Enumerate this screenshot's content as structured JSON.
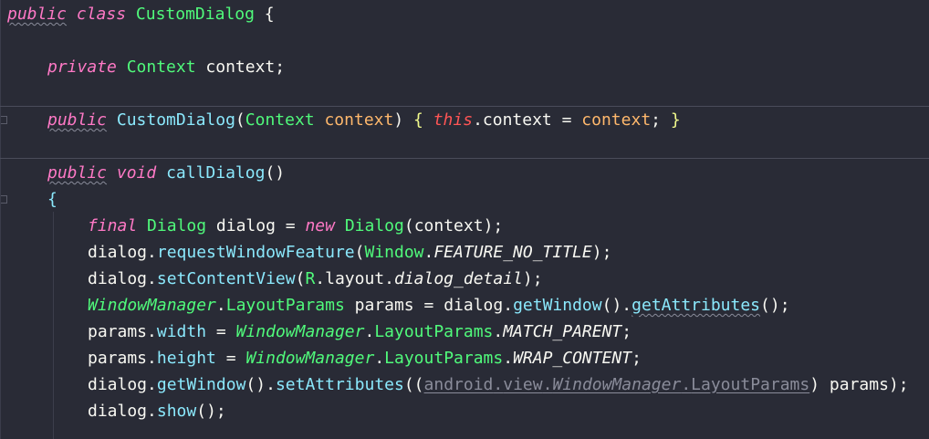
{
  "code": {
    "l1": {
      "public": "public",
      "class": "class",
      "name": "CustomDialog",
      "brace": "{"
    },
    "l2": {
      "private": "private",
      "type": "Context",
      "var": "context",
      "semi": ";"
    },
    "l3": {
      "public": "public",
      "name": "CustomDialog",
      "open": "(",
      "ptype": "Context",
      "pname": "context",
      "close": ")",
      "lbrace": "{",
      "this": "this",
      "dot": ".",
      "field": "context",
      "eq": "=",
      "rhs": "context",
      "semi": ";",
      "rbrace": "}"
    },
    "l4": {
      "public": "public",
      "void": "void",
      "name": "callDialog",
      "parens": "()"
    },
    "l5": {
      "brace": "{"
    },
    "l6": {
      "final": "final",
      "type": "Dialog",
      "var": "dialog",
      "eq": "=",
      "new": "new",
      "ctor": "Dialog",
      "open": "(",
      "arg": "context",
      "close": ");"
    },
    "l7": {
      "obj": "dialog",
      "dot": ".",
      "method": "requestWindowFeature",
      "open": "(",
      "cls": "Window",
      "dot2": ".",
      "const": "FEATURE_NO_TITLE",
      "close": ");"
    },
    "l8": {
      "obj": "dialog",
      "dot": ".",
      "method": "setContentView",
      "open": "(",
      "r": "R",
      "dot2": ".",
      "layout": "layout",
      "dot3": ".",
      "res": "dialog_detail",
      "close": ");"
    },
    "l9": {
      "cls": "WindowManager",
      "dot": ".",
      "inner": "LayoutParams",
      "var": "params",
      "eq": "=",
      "obj": "dialog",
      "dot2": ".",
      "m1": "getWindow",
      "p1": "()",
      "dot3": ".",
      "m2": "getAttributes",
      "p2": "();"
    },
    "l10": {
      "obj": "params",
      "dot": ".",
      "field": "width",
      "eq": "=",
      "cls": "WindowManager",
      "dot2": ".",
      "inner": "LayoutParams",
      "dot3": ".",
      "const": "MATCH_PARENT",
      "semi": ";"
    },
    "l11": {
      "obj": "params",
      "dot": ".",
      "field": "height",
      "eq": "=",
      "cls": "WindowManager",
      "dot2": ".",
      "inner": "LayoutParams",
      "dot3": ".",
      "const": "WRAP_CONTENT",
      "semi": ";"
    },
    "l12": {
      "obj": "dialog",
      "dot": ".",
      "m1": "getWindow",
      "p1": "()",
      "dot2": ".",
      "m2": "setAttributes",
      "open": "((",
      "pkg1": "android",
      "d1": ".",
      "pkg2": "view",
      "d2": ".",
      "pkg3": "WindowManager",
      "d3": ".",
      "pkg4": "LayoutParams",
      "close": ")",
      "arg": "params",
      "end": ");"
    },
    "l13": {
      "obj": "dialog",
      "dot": ".",
      "method": "show",
      "end": "();"
    }
  },
  "colors": {
    "background": "#292b36",
    "keyword": "#ff79c6",
    "type": "#8be9fd",
    "class": "#50fa7b",
    "parameter": "#ffb86c",
    "this": "#ff5555",
    "brace": "#f1fa8c",
    "text": "#f8f8f2"
  }
}
